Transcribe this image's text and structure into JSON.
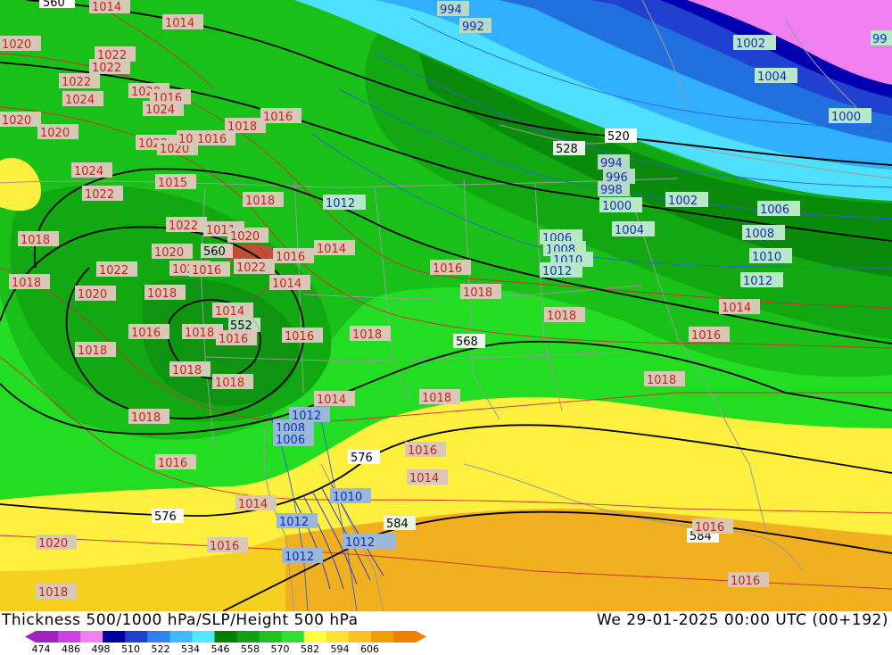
{
  "title_left": "Thickness 500/1000 hPa/SLP/Height 500 hPa",
  "title_right": "We 29-01-2025 00:00 UTC (00+192)",
  "colorbar": {
    "colors": [
      "#a020c0",
      "#d040e0",
      "#f080f0",
      "#0000a0",
      "#2040d0",
      "#3080f0",
      "#40b8ff",
      "#50e8ff",
      "#008000",
      "#10a010",
      "#20c020",
      "#30e030",
      "#ffff40",
      "#ffe030",
      "#ffc020",
      "#f0a000",
      "#f08000"
    ],
    "ticks": [
      "474",
      "486",
      "498",
      "510",
      "522",
      "534",
      "546",
      "558",
      "570",
      "582",
      "594",
      "606"
    ]
  },
  "height_labels": [
    "560",
    "528",
    "520",
    "552",
    "560",
    "568",
    "576",
    "576",
    "584",
    "584"
  ],
  "slp_labels_red": [
    "1014",
    "1014",
    "1020",
    "1022",
    "1022",
    "1022",
    "1020",
    "1016",
    "1024",
    "1024",
    "1020",
    "1020",
    "1022",
    "1020",
    "1018",
    "1016",
    "1018",
    "1016",
    "1024",
    "1015",
    "1022",
    "1018",
    "1022",
    "1011",
    "1020",
    "1018",
    "1020",
    "1016",
    "1014",
    "1022",
    "1020",
    "1016",
    "1022",
    "1016",
    "1018",
    "1020",
    "1014",
    "1014",
    "1018",
    "1020",
    "1018",
    "1014",
    "1016",
    "1018",
    "1016",
    "1018",
    "1018",
    "1014",
    "1018",
    "1014",
    "1018",
    "1018",
    "1016",
    "1014",
    "1014",
    "1018",
    "1016",
    "1014",
    "1018",
    "1016",
    "1016",
    "1020",
    "1016",
    "1018",
    "1018",
    "1016",
    "1014",
    "1016"
  ],
  "slp_labels_blue": [
    "994",
    "992",
    "1002",
    "1004",
    "1000",
    "994",
    "996",
    "998",
    "1000",
    "1002",
    "1006",
    "1004",
    "1006",
    "1008",
    "1010",
    "1012",
    "1008",
    "1010",
    "1012",
    "1012",
    "1008",
    "1006",
    "1012",
    "1010",
    "1012",
    "1012",
    "1012"
  ],
  "fragment_label": "99",
  "icons": [
    "colorbar-left-arrow",
    "colorbar-right-arrow"
  ]
}
